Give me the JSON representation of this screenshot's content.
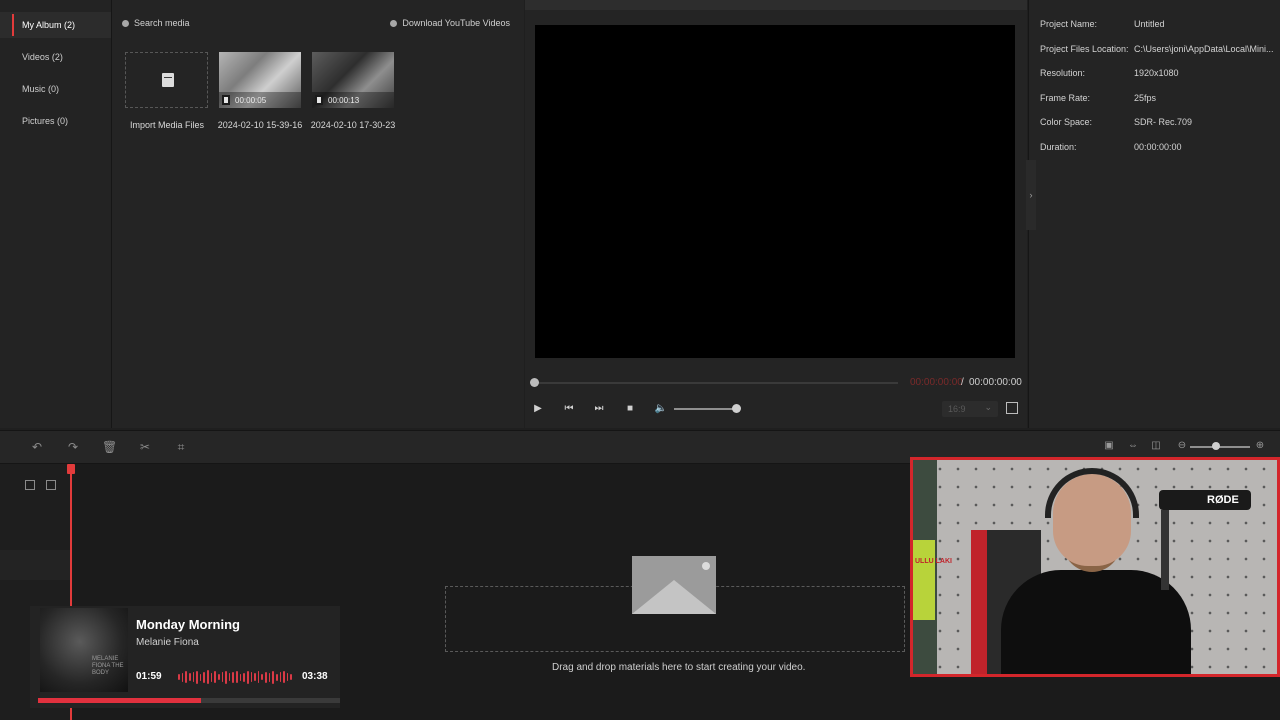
{
  "sidebar": {
    "items": [
      {
        "label": "My Album (2)",
        "active": true
      },
      {
        "label": "Videos (2)",
        "active": false
      },
      {
        "label": "Music (0)",
        "active": false
      },
      {
        "label": "Pictures (0)",
        "active": false
      }
    ]
  },
  "media": {
    "search_label": "Search media",
    "youtube_label": "Download YouTube Videos",
    "import_label": "Import Media Files",
    "items": [
      {
        "duration": "00:00:05",
        "name": "2024-02-10 15-39-16"
      },
      {
        "duration": "00:00:13",
        "name": "2024-02-10 17-30-23"
      }
    ]
  },
  "preview": {
    "current_time": "00:00:00:00",
    "separator": "/",
    "total_time": "00:00:00:00",
    "aspect_ratio": "16:9",
    "volume_level": 1.0
  },
  "properties": {
    "rows": [
      {
        "label": "Project Name:",
        "value": "Untitled"
      },
      {
        "label": "Project Files Location:",
        "value": "C:\\Users\\joni\\AppData\\Local\\Mini..."
      },
      {
        "label": "Resolution:",
        "value": "1920x1080"
      },
      {
        "label": "Frame Rate:",
        "value": "25fps"
      },
      {
        "label": "Color Space:",
        "value": "SDR- Rec.709"
      },
      {
        "label": "Duration:",
        "value": "00:00:00:00"
      }
    ]
  },
  "timeline": {
    "drop_text": "Drag and drop materials here to start creating your video.",
    "zoom_level": 0.4
  },
  "now_playing": {
    "title": "Monday Morning",
    "artist": "Melanie Fiona",
    "elapsed": "01:59",
    "length": "03:38",
    "progress": 0.54,
    "cover_text": "MELANIE FIONA THE BODY"
  },
  "webcam": {
    "mic_brand": "RØDE",
    "can_text": "ULLU LAKI"
  },
  "colors": {
    "accent": "#e23b3b",
    "background": "#1f1f1f",
    "panel": "#242424",
    "now_playing_accent": "#e1313e"
  },
  "icons": {
    "search": "search-icon",
    "youtube": "download-icon",
    "undo": "undo-icon",
    "redo": "redo-icon",
    "delete": "trash-icon",
    "split": "scissors-icon",
    "crop": "crop-icon"
  }
}
